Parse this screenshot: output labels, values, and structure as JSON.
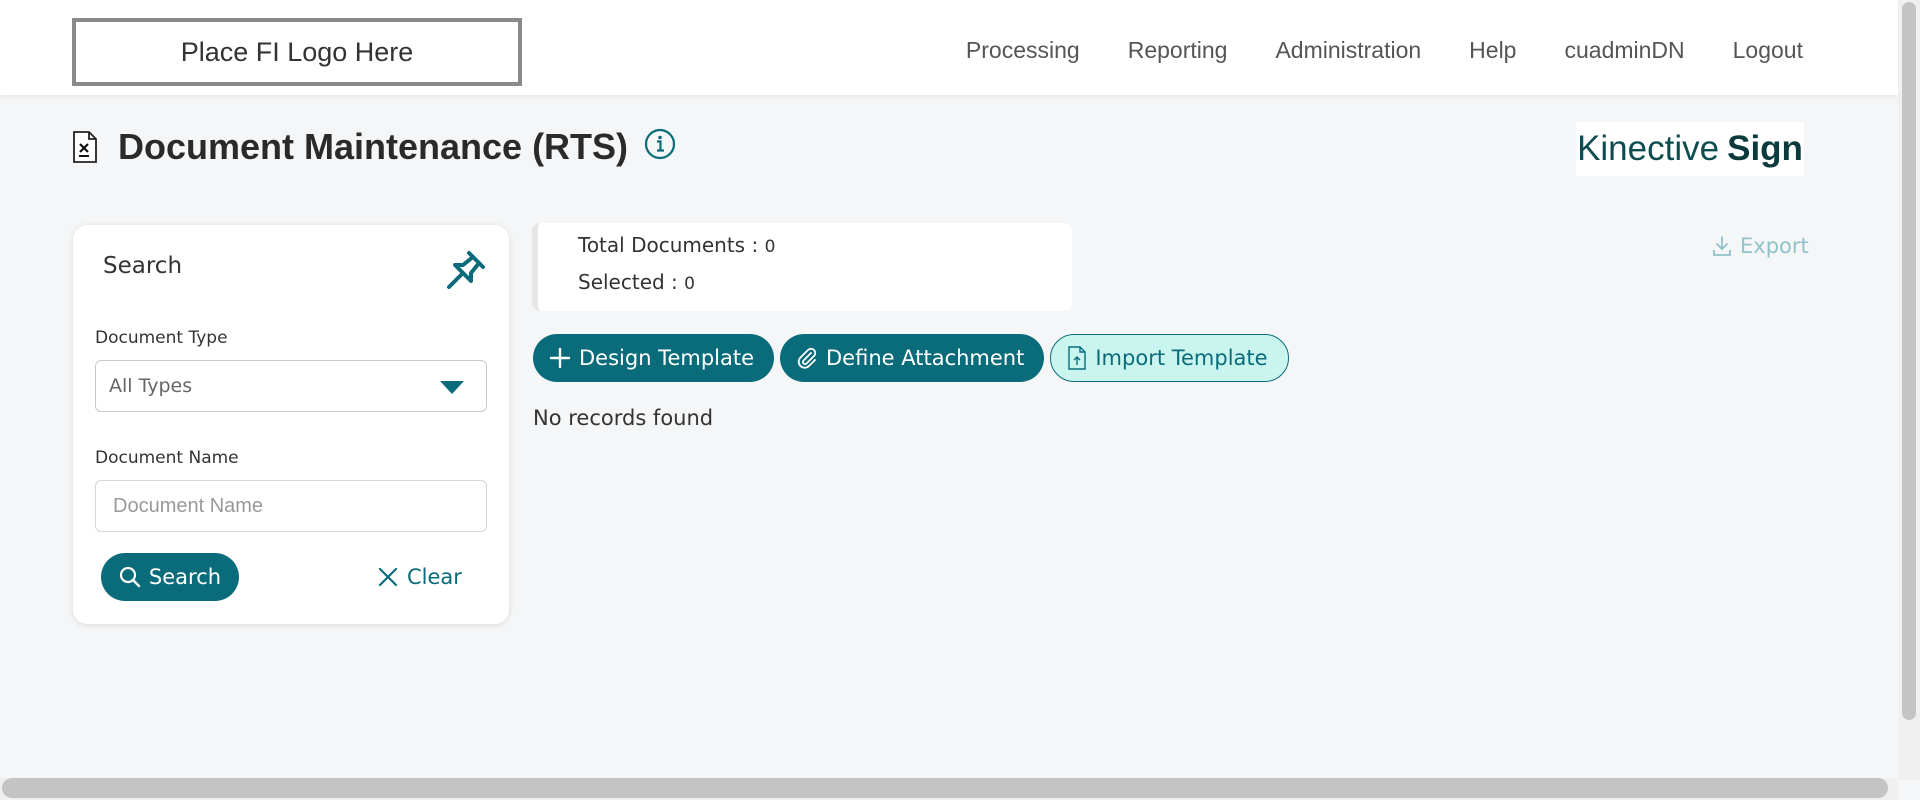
{
  "header": {
    "logo_text": "Place FI Logo Here",
    "nav": [
      "Processing",
      "Reporting",
      "Administration",
      "Help",
      "cuadminDN",
      "Logout"
    ]
  },
  "page": {
    "title": "Document Maintenance (RTS)",
    "brand_light": "Kinective",
    "brand_bold": "Sign"
  },
  "search_panel": {
    "title": "Search",
    "document_type_label": "Document Type",
    "document_type_value": "All Types",
    "document_name_label": "Document Name",
    "document_name_placeholder": "Document Name",
    "search_label": "Search",
    "clear_label": "Clear"
  },
  "summary": {
    "total_label": "Total Documents :",
    "total_value": "0",
    "selected_label": "Selected :",
    "selected_value": "0"
  },
  "export_label": "Export",
  "actions": {
    "design_template": "Design Template",
    "define_attachment": "Define Attachment",
    "import_template": "Import Template"
  },
  "no_records": "No records found",
  "colors": {
    "accent": "#0a6c7a",
    "secondary_bg": "#c9f5ee",
    "export_disabled": "#8fc3c8"
  }
}
